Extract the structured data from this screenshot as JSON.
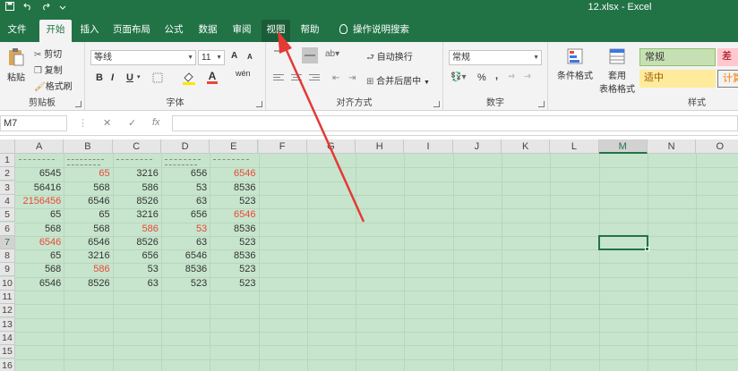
{
  "titlebar": {
    "title": "12.xlsx  -  Excel",
    "qat": [
      "save-icon",
      "undo-icon",
      "redo-icon",
      "customize-icon"
    ]
  },
  "tabs": [
    {
      "label": "文件"
    },
    {
      "label": "开始"
    },
    {
      "label": "插入"
    },
    {
      "label": "页面布局"
    },
    {
      "label": "公式"
    },
    {
      "label": "数据"
    },
    {
      "label": "审阅"
    },
    {
      "label": "视图"
    },
    {
      "label": "帮助"
    },
    {
      "label": "操作说明搜索"
    }
  ],
  "ribbon": {
    "clipboard": {
      "paste": "粘贴",
      "cut": "剪切",
      "copy": "复制",
      "format_painter": "格式刷",
      "label": "剪贴板"
    },
    "font": {
      "name": "等线",
      "size": "11",
      "grow": "A",
      "shrink": "A",
      "bold": "B",
      "italic": "I",
      "underline": "U",
      "underline_caret": "▾",
      "font_color_letter": "A",
      "wen": "wén",
      "label": "字体"
    },
    "alignment": {
      "wrap": "自动换行",
      "merge": "合并后居中",
      "label": "对齐方式"
    },
    "number": {
      "format": "常规",
      "percent": "%",
      "comma": ",",
      "label": "数字"
    },
    "styles": {
      "conditional": "条件格式",
      "table_format_1": "套用",
      "table_format_2": "表格格式",
      "normal": "常规",
      "bad": "差",
      "neutral": "适中",
      "calc": "计算",
      "label": "样式"
    }
  },
  "formula_bar": {
    "name_box": "M7",
    "cancel": "✕",
    "enter": "✓",
    "fx": "fx",
    "value": ""
  },
  "grid": {
    "columns": [
      "A",
      "B",
      "C",
      "D",
      "E",
      "F",
      "G",
      "H",
      "I",
      "J",
      "K",
      "L",
      "M",
      "N",
      "O"
    ],
    "rows": [
      "1",
      "2",
      "3",
      "4",
      "5",
      "6",
      "7",
      "8",
      "9",
      "10",
      "11",
      "12",
      "13",
      "14",
      "15",
      "16"
    ],
    "selected_column": "M",
    "selected_row": "7",
    "data": [
      [
        {
          "v": "6545"
        },
        {
          "v": "65",
          "red": true
        },
        {
          "v": "3216"
        },
        {
          "v": "656"
        },
        {
          "v": "6546",
          "red": true
        }
      ],
      [
        {
          "v": "56416"
        },
        {
          "v": "568"
        },
        {
          "v": "586"
        },
        {
          "v": "53"
        },
        {
          "v": "8536"
        }
      ],
      [
        {
          "v": "2156456",
          "red": true
        },
        {
          "v": "6546"
        },
        {
          "v": "8526"
        },
        {
          "v": "63"
        },
        {
          "v": "523"
        }
      ],
      [
        {
          "v": "65"
        },
        {
          "v": "65"
        },
        {
          "v": "3216"
        },
        {
          "v": "656"
        },
        {
          "v": "6546",
          "red": true
        }
      ],
      [
        {
          "v": "568"
        },
        {
          "v": "568"
        },
        {
          "v": "586",
          "red": true
        },
        {
          "v": "53",
          "red": true
        },
        {
          "v": "8536"
        }
      ],
      [
        {
          "v": "6546",
          "red": true
        },
        {
          "v": "6546"
        },
        {
          "v": "8526"
        },
        {
          "v": "63"
        },
        {
          "v": "523"
        }
      ],
      [
        {
          "v": "65"
        },
        {
          "v": "3216"
        },
        {
          "v": "656"
        },
        {
          "v": "6546"
        },
        {
          "v": "8536"
        }
      ],
      [
        {
          "v": "568"
        },
        {
          "v": "586",
          "red": true
        },
        {
          "v": "53"
        },
        {
          "v": "8536"
        },
        {
          "v": "523"
        }
      ],
      [
        {
          "v": "6546"
        },
        {
          "v": "8526"
        },
        {
          "v": "63"
        },
        {
          "v": "523"
        },
        {
          "v": "523"
        }
      ]
    ]
  },
  "colors": {
    "excel_green": "#217346",
    "sheet_bg": "#c7e5cc",
    "red_text": "#e8483b",
    "annotation_arrow": "#e53935"
  }
}
